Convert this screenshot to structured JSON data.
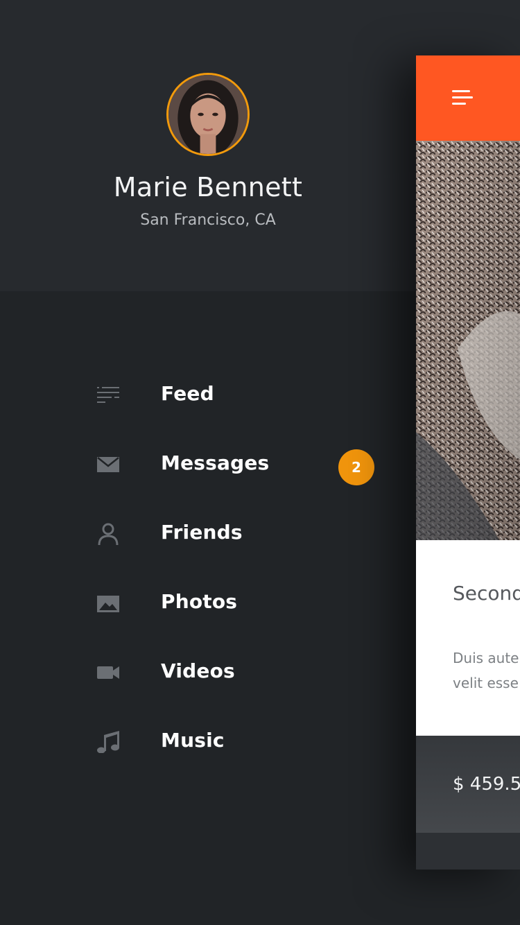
{
  "profile": {
    "name": "Marie Bennett",
    "location": "San Francisco, CA",
    "avatar_icon": "avatar-photo",
    "avatar_ring_color": "#f29a0c"
  },
  "menu": {
    "items": [
      {
        "label": "Feed",
        "icon": "feed-icon"
      },
      {
        "label": "Messages",
        "icon": "envelope-icon",
        "badge": "2"
      },
      {
        "label": "Friends",
        "icon": "person-icon"
      },
      {
        "label": "Photos",
        "icon": "image-icon"
      },
      {
        "label": "Videos",
        "icon": "video-camera-icon"
      },
      {
        "label": "Music",
        "icon": "music-note-icon"
      }
    ]
  },
  "main": {
    "topbar_color": "#ff5722",
    "menu_icon": "hamburger-icon",
    "card": {
      "title": "Second",
      "text_line1": "Duis aute",
      "text_line2": "velit esse",
      "price": "$ 459.5"
    }
  },
  "colors": {
    "drawer_background": "#212427",
    "header_background": "#272a2e",
    "badge": "#f0940c"
  }
}
